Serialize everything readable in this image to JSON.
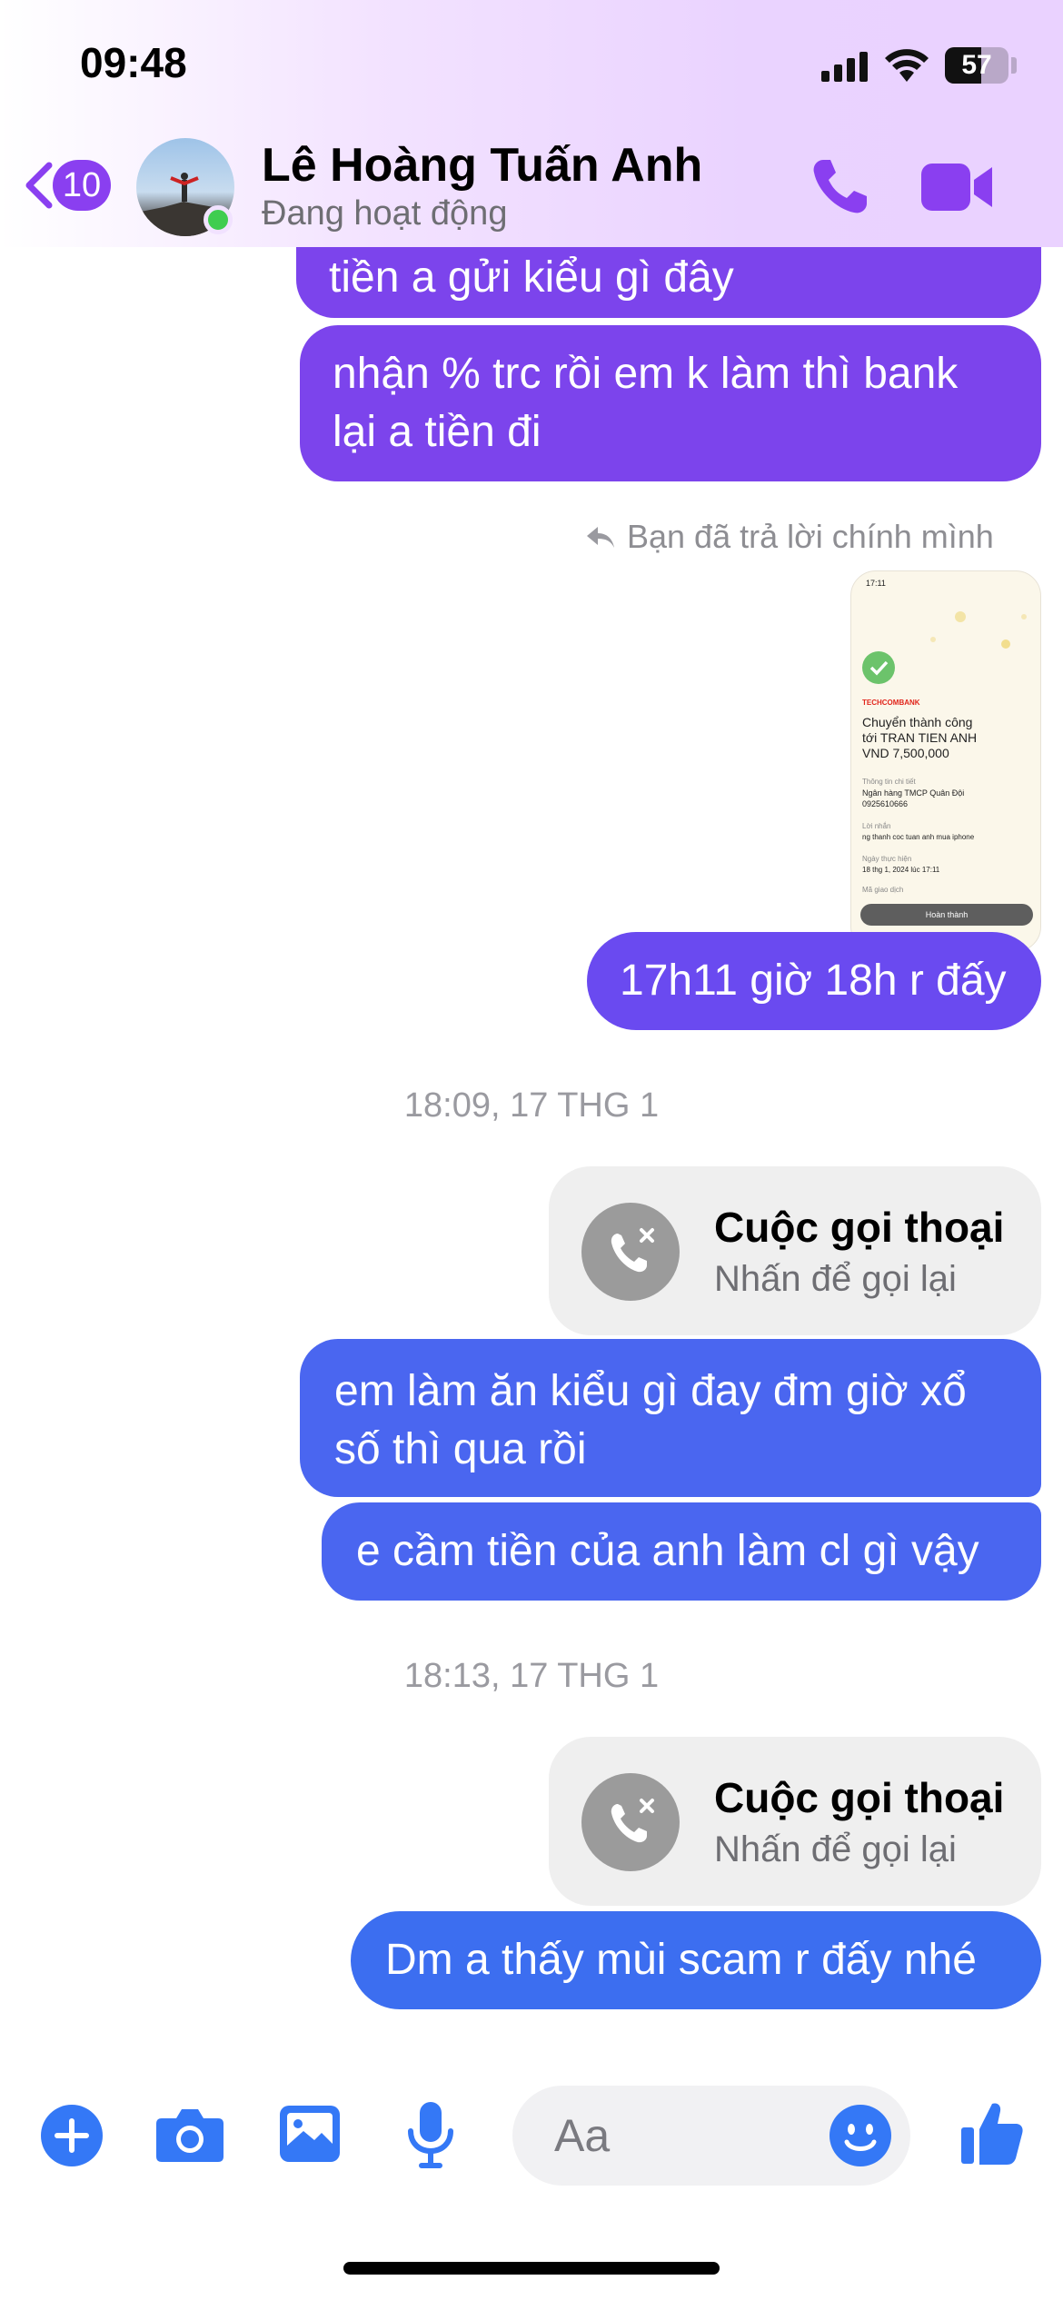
{
  "status_bar": {
    "time": "09:48",
    "battery": "57",
    "battery_level": 0.57
  },
  "header": {
    "back_count": "10",
    "contact_name": "Lê Hoàng Tuấn Anh",
    "contact_status": "Đang hoạt động",
    "icons": {
      "back": "chevron-left-icon",
      "call": "phone-icon",
      "video": "video-camera-icon"
    },
    "accent_color": "#8a3ff0"
  },
  "messages": {
    "m1": "tiền a gửi kiểu gì đây",
    "m2_line1": "nhận % trc rồi em k làm thì bank",
    "m2_line2": "lại a tiền đi",
    "reply_note": "Bạn đã trả lời chính mình",
    "receipt": {
      "time": "17:11",
      "brand": "TECHCOMBANK",
      "line1": "Chuyển thành công",
      "line2": "tới TRAN TIEN ANH",
      "amount": "VND 7,500,000",
      "detail_label": "Thông tin chi tiết",
      "bank": "Ngân hàng TMCP Quân Đội",
      "account": "0925610666",
      "note_label": "Lời nhắn",
      "note": "ng thanh coc tuan anh mua iphone",
      "date_label": "Ngày thực hiện",
      "date": "18 thg 1, 2024 lúc 17:11",
      "txn_label": "Mã giao dịch",
      "done_button": "Hoàn thành"
    },
    "m3": "17h11 giờ 18h r đấy",
    "ts1": "18:09, 17 THG 1",
    "call1_title": "Cuộc gọi thoại",
    "call1_sub": "Nhấn để gọi lại",
    "m4_line1": "em làm ăn kiểu gì đay đm giờ xổ",
    "m4_line2": "số thì qua rồi",
    "m5": "e cầm tiền của anh làm cl gì vậy",
    "ts2": "18:13, 17 THG 1",
    "call2_title": "Cuộc gọi thoại",
    "call2_sub": "Nhấn để gọi lại",
    "m6": "Dm a thấy mùi scam r đấy nhé"
  },
  "composer": {
    "placeholder": "Aa",
    "icons": [
      "plus-icon",
      "camera-icon",
      "image-icon",
      "microphone-icon",
      "emoji-icon",
      "thumbs-up-icon"
    ],
    "icon_color": "#3478f6"
  }
}
